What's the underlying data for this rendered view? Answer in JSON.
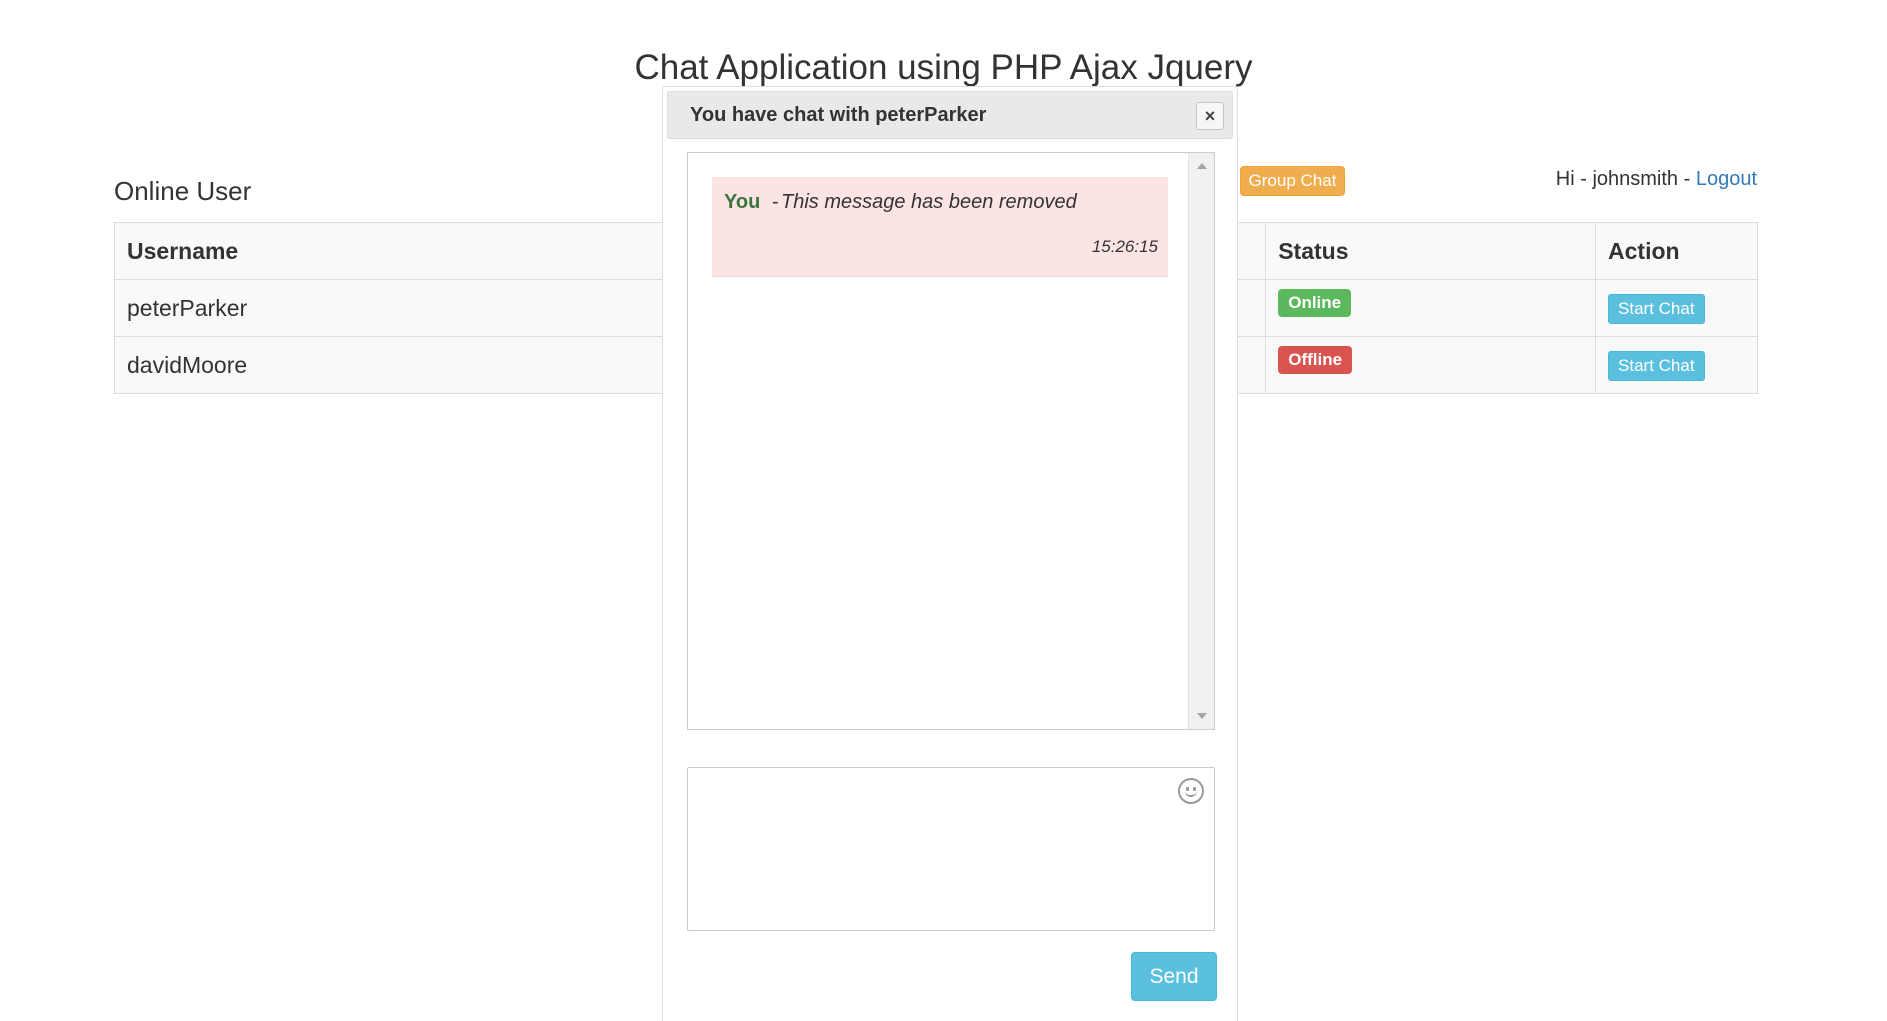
{
  "page": {
    "title": "Chat Application using PHP Ajax Jquery"
  },
  "online_users": {
    "title": "Online User",
    "group_chat_label": "Group Chat",
    "greeting": "Hi - johnsmith - ",
    "logout_label": "Logout",
    "columns": [
      "Username",
      "Status",
      "Action"
    ],
    "rows": [
      {
        "username": "peterParker",
        "status": "Online",
        "action": "Start Chat"
      },
      {
        "username": "davidMoore",
        "status": "Offline",
        "action": "Start Chat"
      }
    ]
  },
  "dialog": {
    "title": "You have chat with peterParker",
    "close_label": "×",
    "messages": [
      {
        "author": "You",
        "separator": "-",
        "text": "This message has been removed",
        "time": "15:26:15"
      }
    ],
    "compose_placeholder": "",
    "send_label": "Send"
  },
  "colors": {
    "online": "#5cb85c",
    "offline": "#d9534f",
    "info_button": "#5bc0de",
    "warning_button": "#f0ad4e",
    "message_bg": "#fce4e4",
    "author": "#3c763d",
    "link": "#337ab7"
  },
  "icons": {
    "emoji": "smiley-face-icon",
    "close": "close-icon",
    "scroll_up": "scroll-up-arrow-icon",
    "scroll_down": "scroll-down-arrow-icon"
  }
}
